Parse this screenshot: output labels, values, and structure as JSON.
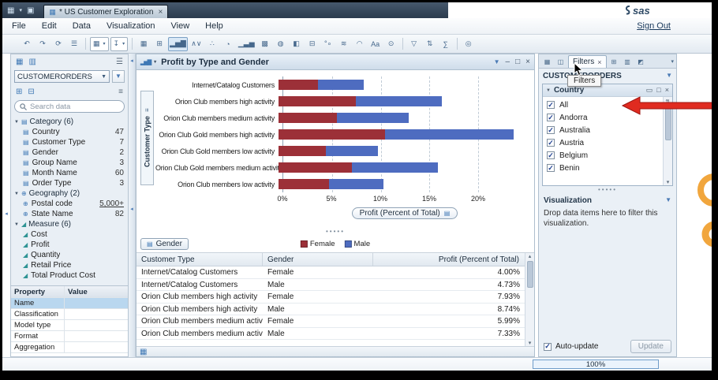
{
  "window": {
    "tab_title": "* US Customer Exploration",
    "tab_close": "×",
    "menus": [
      "File",
      "Edit",
      "Data",
      "Visualization",
      "View",
      "Help"
    ],
    "sign_out": "Sign Out",
    "logo_text": "sas"
  },
  "icons": {
    "caret": "▾",
    "caret_solid": "▼",
    "close": "×",
    "minimize": "–",
    "maximize": "□",
    "panel_restore": "▭",
    "menu": "☰",
    "menu2": "≡",
    "grid": "▦",
    "grid2": "▥",
    "new_tab": "▣",
    "expand": "⊞",
    "collapse": "⊟",
    "check": "✓",
    "sort": "⇅",
    "scroll_up": "▴",
    "scroll_down": "▾",
    "grip_dots": "•••••",
    "funnel": "▼",
    "axis_menu": "▤",
    "bar_mini": "▂▅▇",
    "category-icon": "▤",
    "geography-icon": "⊕",
    "measure-icon": "◢"
  },
  "toolbar": {
    "items": [
      {
        "name": "undo-icon",
        "glyph": "↶"
      },
      {
        "name": "redo-icon",
        "glyph": "↷"
      },
      {
        "name": "refresh-icon",
        "glyph": "⟳"
      },
      {
        "name": "window-menu-icon",
        "glyph": "☰"
      },
      {
        "sep": true
      },
      {
        "name": "view-selector",
        "glyph": "▦",
        "boxed": true,
        "caret": true
      },
      {
        "name": "export-selector",
        "glyph": "↧",
        "boxed": true,
        "caret": true
      },
      {
        "sep": true
      },
      {
        "name": "table-visualization-icon",
        "glyph": "▦"
      },
      {
        "name": "crosstab-visualization-icon",
        "glyph": "⊞"
      },
      {
        "name": "bar-chart-visualization-icon",
        "glyph": "▂▅▇",
        "active": true
      },
      {
        "name": "line-chart-visualization-icon",
        "glyph": "∧∨"
      },
      {
        "name": "scatter-plot-visualization-icon",
        "glyph": "∴"
      },
      {
        "name": "pie-chart-visualization-icon",
        "glyph": "◔"
      },
      {
        "name": "histogram-visualization-icon",
        "glyph": "▁▃▅"
      },
      {
        "name": "heat-map-visualization-icon",
        "glyph": "▩"
      },
      {
        "name": "geo-map-visualization-icon",
        "glyph": "◍"
      },
      {
        "name": "treemap-visualization-icon",
        "glyph": "◧"
      },
      {
        "name": "box-plot-visualization-icon",
        "glyph": "⊟"
      },
      {
        "name": "bubble-plot-visualization-icon",
        "glyph": "°∘"
      },
      {
        "name": "band-plot-visualization-icon",
        "glyph": "≋"
      },
      {
        "name": "gauge-visualization-icon",
        "glyph": "◠"
      },
      {
        "name": "word-cloud-visualization-icon",
        "glyph": "Aa"
      },
      {
        "name": "network-visualization-icon",
        "glyph": "⊙"
      },
      {
        "sep": true
      },
      {
        "name": "filter-tool-icon",
        "glyph": "▽"
      },
      {
        "name": "sort-tool-icon",
        "glyph": "⇅"
      },
      {
        "name": "calculation-icon",
        "glyph": "∑"
      },
      {
        "sep": true
      },
      {
        "name": "capture-icon",
        "glyph": "◎"
      }
    ]
  },
  "data_panel": {
    "source_select": "CUSTOMERORDERS",
    "search_placeholder": "Search data",
    "groups": [
      {
        "label": "Category (6)",
        "icon": "category-icon",
        "items": [
          {
            "name": "Country",
            "count": "47"
          },
          {
            "name": "Customer Type",
            "count": "7"
          },
          {
            "name": "Gender",
            "count": "2"
          },
          {
            "name": "Group Name",
            "count": "3"
          },
          {
            "name": "Month Name",
            "count": "60"
          },
          {
            "name": "Order Type",
            "count": "3"
          }
        ]
      },
      {
        "label": "Geography (2)",
        "icon": "geography-icon",
        "items": [
          {
            "name": "Postal code",
            "count": "5,000+",
            "link": true
          },
          {
            "name": "State Name",
            "count": "82"
          }
        ]
      },
      {
        "label": "Measure (6)",
        "icon": "measure-icon",
        "items": [
          {
            "name": "Cost",
            "count": ""
          },
          {
            "name": "Profit",
            "count": ""
          },
          {
            "name": "Quantity",
            "count": ""
          },
          {
            "name": "Retail Price",
            "count": ""
          },
          {
            "name": "Total Product Cost",
            "count": ""
          }
        ]
      }
    ],
    "properties": {
      "headers": [
        "Property",
        "Value"
      ],
      "rows": [
        {
          "property": "Name",
          "value": "",
          "selected": true
        },
        {
          "property": "Classification",
          "value": ""
        },
        {
          "property": "Model type",
          "value": ""
        },
        {
          "property": "Format",
          "value": ""
        },
        {
          "property": "Aggregation",
          "value": ""
        }
      ]
    }
  },
  "visualization_panel": {
    "title": "Profit by Type and Gender",
    "gender_button": "Gender",
    "table": {
      "headers": [
        "Customer Type",
        "Gender",
        "Profit (Percent of Total)"
      ],
      "rows": [
        [
          "Internet/Catalog Customers",
          "Female",
          "4.00%"
        ],
        [
          "Internet/Catalog Customers",
          "Male",
          "4.73%"
        ],
        [
          "Orion Club members high activity",
          "Female",
          "7.93%"
        ],
        [
          "Orion Club members high activity",
          "Male",
          "8.74%"
        ],
        [
          "Orion Club members medium activity",
          "Female",
          "5.99%"
        ],
        [
          "Orion Club members medium activity",
          "Male",
          "7.33%"
        ]
      ]
    }
  },
  "chart_data": {
    "type": "bar",
    "orientation": "horizontal",
    "stacked": true,
    "title": "Profit by Type and Gender",
    "xlabel": "Profit (Percent of Total)",
    "ylabel": "Customer Type",
    "xlim": [
      0,
      25
    ],
    "x_ticks": [
      "0%",
      "5%",
      "10%",
      "15%",
      "20%"
    ],
    "grid": "dashed-vertical",
    "legend_position": "bottom",
    "categories": [
      "Internet/Catalog Customers",
      "Orion Club members high activity",
      "Orion Club members medium activity",
      "Orion Club Gold members high activity",
      "Orion Club Gold members low activity",
      "Orion Club Gold members medium activity",
      "Orion Club members low activity"
    ],
    "series": [
      {
        "name": "Female",
        "color": "#9c3038",
        "values": [
          4.0,
          7.93,
          5.99,
          10.92,
          4.8,
          7.5,
          5.2
        ]
      },
      {
        "name": "Male",
        "color": "#4e6cc0",
        "values": [
          4.73,
          8.74,
          7.33,
          13.15,
          5.4,
          8.8,
          5.5
        ]
      }
    ]
  },
  "filters_panel": {
    "tab_label": "Filters",
    "tab_close": "×",
    "tooltip": "Filters",
    "source": "CUSTOMERORDERS",
    "tab_icons_left": [
      {
        "name": "properties-tab-icon",
        "glyph": "▦"
      },
      {
        "name": "data-tab-icon",
        "glyph": "◫"
      }
    ],
    "tab_icons_right": [
      {
        "name": "ranks-tab-icon",
        "glyph": "⊞"
      },
      {
        "name": "comments-tab-icon",
        "glyph": "▥"
      },
      {
        "name": "details-tab-icon",
        "glyph": "◩"
      }
    ],
    "country_filter": {
      "title": "Country",
      "options": [
        {
          "label": "All",
          "checked": true
        },
        {
          "label": "Andorra",
          "checked": true
        },
        {
          "label": "Australia",
          "checked": true
        },
        {
          "label": "Austria",
          "checked": true
        },
        {
          "label": "Belgium",
          "checked": true
        },
        {
          "label": "Benin",
          "checked": true
        }
      ]
    },
    "visualization_filter": {
      "title": "Visualization",
      "hint": "Drop data items here to filter this visualization."
    },
    "auto_update_label": "Auto-update",
    "auto_update_checked": true,
    "update_button": "Update"
  },
  "status": {
    "progress_label": "100%"
  },
  "colors": {
    "female": "#9c3038",
    "male": "#4e6cc0",
    "annotation_arrow": "#e02b20",
    "annotation_blob": "#f1a63d",
    "selected_row": "#b9d7ef"
  }
}
